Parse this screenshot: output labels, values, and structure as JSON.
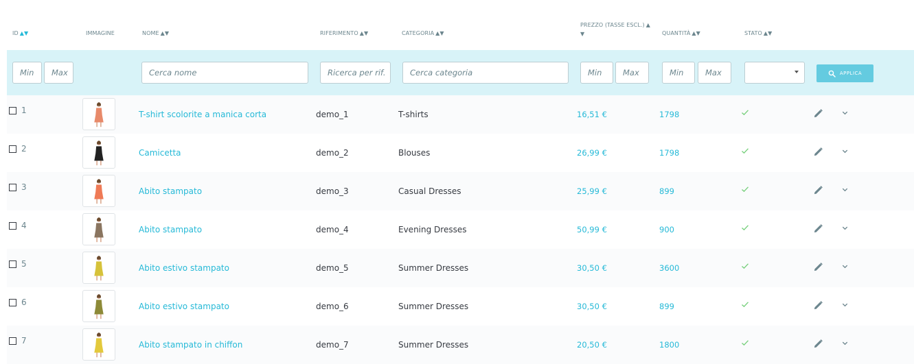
{
  "header": {
    "id": "ID",
    "image": "IMMAGINE",
    "name": "NOME",
    "reference": "RIFERIMENTO",
    "category": "CATEGORIA",
    "price_line1": "PREZZO (TASSE ESCL.)",
    "quantity": "QUANTITÀ",
    "status": "STATO",
    "sort_arrows": "▲▼",
    "sort_up": "▲",
    "sort_down": "▼"
  },
  "filters": {
    "id_min": "Min",
    "id_max": "Max",
    "name": "Cerca nome",
    "reference": "Ricerca per rif.",
    "category": "Cerca categoria",
    "price_min": "Min",
    "price_max": "Max",
    "qty_min": "Min",
    "qty_max": "Max",
    "status_value": "",
    "apply_label": "APPLICA"
  },
  "colors": {
    "accent": "#25b9d7",
    "filter_bg": "#d8f3f8",
    "button": "#64cbe0",
    "check": "#78d07d"
  },
  "icons": {
    "search": "search-icon",
    "status": "check-icon",
    "edit": "pencil-icon",
    "more": "chevron-down-icon"
  },
  "products": [
    {
      "id": "1",
      "name": "T-shirt scolorite a manica corta",
      "reference": "demo_1",
      "category": "T-shirts",
      "price": "16,51 €",
      "quantity": "1798",
      "active": true,
      "thumb_color": "#e88a6a"
    },
    {
      "id": "2",
      "name": "Camicetta",
      "reference": "demo_2",
      "category": "Blouses",
      "price": "26,99 €",
      "quantity": "1798",
      "active": true,
      "thumb_color": "#222222"
    },
    {
      "id": "3",
      "name": "Abito stampato",
      "reference": "demo_3",
      "category": "Casual Dresses",
      "price": "25,99 €",
      "quantity": "899",
      "active": true,
      "thumb_color": "#ef7a56"
    },
    {
      "id": "4",
      "name": "Abito stampato",
      "reference": "demo_4",
      "category": "Evening Dresses",
      "price": "50,99 €",
      "quantity": "900",
      "active": true,
      "thumb_color": "#8a7560"
    },
    {
      "id": "5",
      "name": "Abito estivo stampato",
      "reference": "demo_5",
      "category": "Summer Dresses",
      "price": "30,50 €",
      "quantity": "3600",
      "active": true,
      "thumb_color": "#d6c23a"
    },
    {
      "id": "6",
      "name": "Abito estivo stampato",
      "reference": "demo_6",
      "category": "Summer Dresses",
      "price": "30,50 €",
      "quantity": "899",
      "active": true,
      "thumb_color": "#8d8a38"
    },
    {
      "id": "7",
      "name": "Abito stampato in chiffon",
      "reference": "demo_7",
      "category": "Summer Dresses",
      "price": "20,50 €",
      "quantity": "1800",
      "active": true,
      "thumb_color": "#e3c93c"
    }
  ]
}
